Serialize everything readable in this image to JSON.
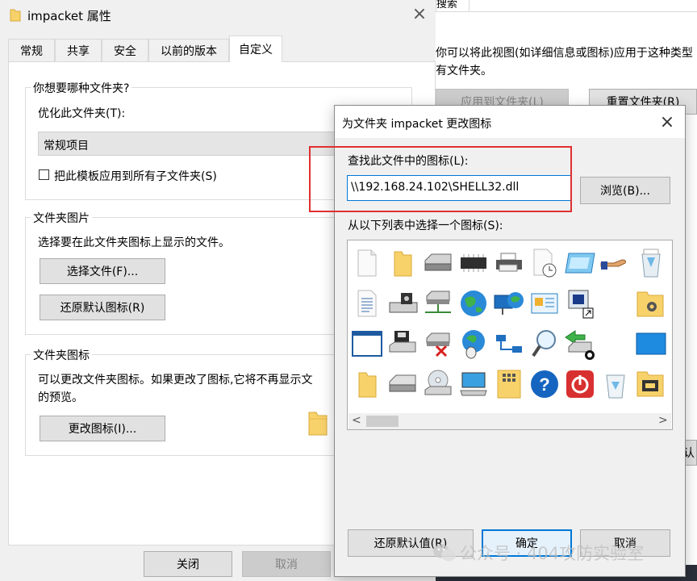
{
  "bg_window": {
    "tab_search": "搜索",
    "line1": "你可以将此视图(如详细信息或图标)应用于这种类型",
    "line2": "有文件夹。",
    "apply_btn": "应用到文件夹(L)",
    "reset_btn": "重置文件夹(R)",
    "partial_btn": "认"
  },
  "props": {
    "title": "impacket 属性",
    "close": "×",
    "tabs": [
      "常规",
      "共享",
      "安全",
      "以前的版本",
      "自定义"
    ],
    "active_tab": 4,
    "g1_legend": "你想要哪种文件夹?",
    "optimize_label": "优化此文件夹(T):",
    "optimize_value": "常规项目",
    "subfolders_check": "把此模板应用到所有子文件夹(S)",
    "g2_legend": "文件夹图片",
    "g2_desc": "选择要在此文件夹图标上显示的文件。",
    "choose_file_btn": "选择文件(F)...",
    "restore_default_btn": "还原默认图标(R)",
    "g3_legend": "文件夹图标",
    "g3_desc1": "可以更改文件夹图标。如果更改了图标,它将不再显示文",
    "g3_desc2": "的预览。",
    "change_icon_btn": "更改图标(I)...",
    "close_btn": "关闭",
    "cancel_btn": "取消"
  },
  "dialog": {
    "title": "为文件夹 impacket 更改图标",
    "close": "×",
    "find_label": "查找此文件中的图标(L):",
    "path_value": "\\\\192.168.24.102\\SHELL32.dll",
    "browse_btn": "浏览(B)...",
    "list_label": "从以下列表中选择一个图标(S):",
    "restore_btn": "还原默认值(R)",
    "ok_btn": "确定",
    "cancel_btn": "取消",
    "highlight_color": "#e03030",
    "scroll_left": "<",
    "scroll_right": ">",
    "icons": [
      [
        "blank-document",
        "folder",
        "drive",
        "chip",
        "printer",
        "clock-document",
        "window-app",
        "hand-share",
        "recycle-bin-full"
      ],
      [
        "text-document",
        "tape-drive",
        "network-drive",
        "globe",
        "network-globe",
        "control-panel",
        "film-shortcut",
        "",
        "folder-gear"
      ],
      [
        "window-frame",
        "floppy-drive",
        "disconnected-drive",
        "globe-mouse",
        "network",
        "magnifier",
        "drive-arrow",
        "",
        "blue-screen"
      ],
      [
        "folder-yellow",
        "hard-drive",
        "cd-drive",
        "computer",
        "grid-folder",
        "help",
        "power",
        "recycle-bin-empty",
        "folder-tools"
      ]
    ]
  },
  "watermark": {
    "text": "公众号 · 404攻防实验室"
  }
}
